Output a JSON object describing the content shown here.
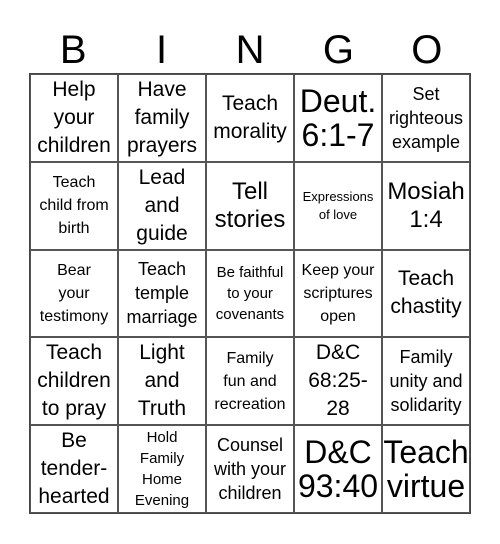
{
  "header": {
    "letters": [
      "B",
      "I",
      "N",
      "G",
      "O"
    ]
  },
  "cells": [
    {
      "text": "Help\nyour\nchildren",
      "size": "ml"
    },
    {
      "text": "Have\nfamily\nprayers",
      "size": "ml"
    },
    {
      "text": "Teach\nmorality",
      "size": "ml"
    },
    {
      "text": "Deut.\n6:1-7",
      "size": "xl"
    },
    {
      "text": "Set\nrighteous\nexample",
      "size": "m"
    },
    {
      "text": "Teach\nchild from\nbirth",
      "size": "s"
    },
    {
      "text": "Lead\nand\nguide",
      "size": "ml"
    },
    {
      "text": "Tell\nstories",
      "size": "l"
    },
    {
      "text": "Expressions\nof love",
      "size": "xxs"
    },
    {
      "text": "Mosiah\n1:4",
      "size": "l"
    },
    {
      "text": "Bear\nyour\ntestimony",
      "size": "s"
    },
    {
      "text": "Teach\ntemple\nmarriage",
      "size": "m"
    },
    {
      "text": "Be faithful\nto your\ncovenants",
      "size": "xs"
    },
    {
      "text": "Keep your\nscriptures\nopen",
      "size": "s"
    },
    {
      "text": "Teach\nchastity",
      "size": "ml"
    },
    {
      "text": "Teach\nchildren\nto pray",
      "size": "ml"
    },
    {
      "text": "Light\nand\nTruth",
      "size": "ml"
    },
    {
      "text": "Family\nfun and\nrecreation",
      "size": "s"
    },
    {
      "text": "D&C\n68:25-\n28",
      "size": "ml"
    },
    {
      "text": "Family\nunity and\nsolidarity",
      "size": "m"
    },
    {
      "text": "Be\ntender-\nhearted",
      "size": "ml"
    },
    {
      "text": "Hold\nFamily\nHome\nEvening",
      "size": "xs"
    },
    {
      "text": "Counsel\nwith your\nchildren",
      "size": "m"
    },
    {
      "text": "D&C\n93:40",
      "size": "xl"
    },
    {
      "text": "Teach\nvirtue",
      "size": "xl"
    }
  ]
}
